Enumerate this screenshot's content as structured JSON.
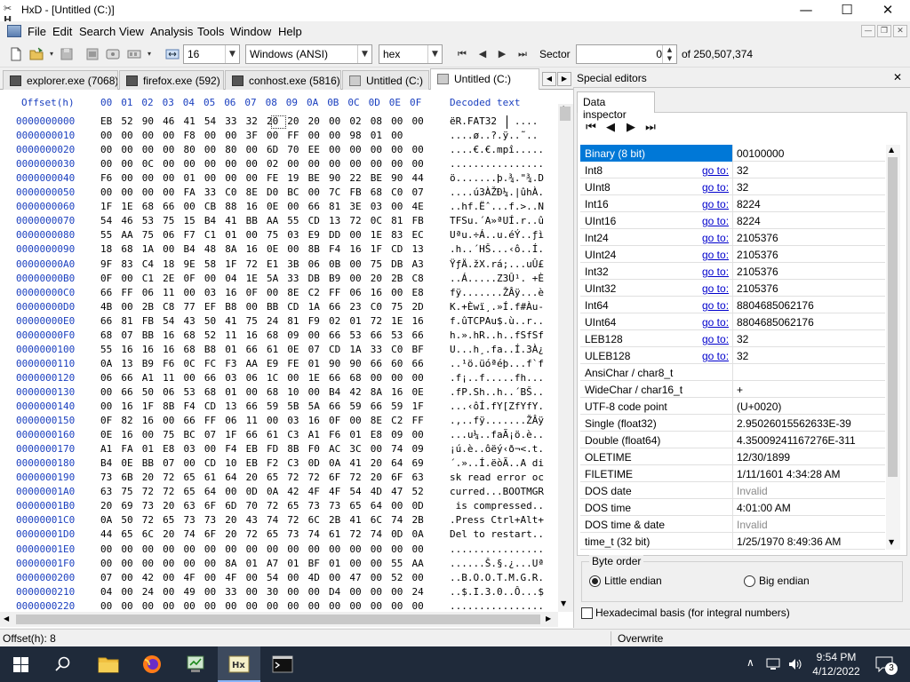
{
  "window": {
    "title": "HxD - [Untitled (C:)]",
    "app_icon_text": "✂H",
    "controls": {
      "minimize": "—",
      "maximize": "☐",
      "close": "✕"
    }
  },
  "menu": [
    "File",
    "Edit",
    "Search",
    "View",
    "Analysis",
    "Tools",
    "Window",
    "Help"
  ],
  "mdi_controls": {
    "minimize": "—",
    "restore": "❐",
    "close": "✕"
  },
  "toolbar": {
    "bytes_per_row": "16",
    "charset": "Windows (ANSI)",
    "offset_base": "hex",
    "sector_label": "Sector",
    "sector_value": "0",
    "sector_total": "of 250,507,374"
  },
  "tabs": [
    {
      "label": "explorer.exe (7068)"
    },
    {
      "label": "firefox.exe (592)"
    },
    {
      "label": "conhost.exe (5816)"
    },
    {
      "label": "Untitled (C:)"
    },
    {
      "label": "Untitled (C:)"
    }
  ],
  "hex": {
    "offset_header": "Offset(h)",
    "columns": [
      "00",
      "01",
      "02",
      "03",
      "04",
      "05",
      "06",
      "07",
      "08",
      "09",
      "0A",
      "0B",
      "0C",
      "0D",
      "0E",
      "0F"
    ],
    "decoded_header": "Decoded text",
    "rows": [
      {
        "offset": "0000000000",
        "bytes": "EB 52 90 46 41 54 33 32 20 20 20 00 02 08 00 00",
        "text": "ëR.FAT32   ...."
      },
      {
        "offset": "0000000010",
        "bytes": "00 00 00 00 F8 00 00 3F 00 FF 00 00 98 01 00",
        "text": "....ø..?.ÿ..˜.."
      },
      {
        "offset": "0000000020",
        "bytes": "00 00 00 00 80 00 80 00 6D 70 EE 00 00 00 00 00",
        "text": "....€.€.mpî....."
      },
      {
        "offset": "0000000030",
        "bytes": "00 00 0C 00 00 00 00 00 02 00 00 00 00 00 00 00",
        "text": "................"
      },
      {
        "offset": "0000000040",
        "bytes": "F6 00 00 00 01 00 00 00 FE 19 BE 90 22 BE 90 44",
        "text": "ö.......þ.¾.\"¾.D"
      },
      {
        "offset": "0000000050",
        "bytes": "00 00 00 00 FA 33 C0 8E D0 BC 00 7C FB 68 C0 07",
        "text": "....ú3ÀŽÐ¼.|ûhÀ."
      },
      {
        "offset": "0000000060",
        "bytes": "1F 1E 68 66 00 CB 88 16 0E 00 66 81 3E 03 00 4E",
        "text": "..hf.Ëˆ...f.>..N"
      },
      {
        "offset": "0000000070",
        "bytes": "54 46 53 75 15 B4 41 BB AA 55 CD 13 72 0C 81 FB",
        "text": "TFSu.´A»ªUÍ.r..û"
      },
      {
        "offset": "0000000080",
        "bytes": "55 AA 75 06 F7 C1 01 00 75 03 E9 DD 00 1E 83 EC",
        "text": "Uªu.÷Á..u.éÝ..ƒì"
      },
      {
        "offset": "0000000090",
        "bytes": "18 68 1A 00 B4 48 8A 16 0E 00 8B F4 16 1F CD 13",
        "text": ".h..´HŠ...‹ô..Í."
      },
      {
        "offset": "00000000A0",
        "bytes": "9F 83 C4 18 9E 58 1F 72 E1 3B 06 0B 00 75 DB A3",
        "text": "ŸƒÄ.žX.rá;...uÛ£"
      },
      {
        "offset": "00000000B0",
        "bytes": "0F 00 C1 2E 0F 00 04 1E 5A 33 DB B9 00 20 2B C8",
        "text": "..Á.....Z3Û¹. +È"
      },
      {
        "offset": "00000000C0",
        "bytes": "66 FF 06 11 00 03 16 0F 00 8E C2 FF 06 16 00 E8",
        "text": "fÿ.......ŽÂÿ...è"
      },
      {
        "offset": "00000000D0",
        "bytes": "4B 00 2B C8 77 EF B8 00 BB CD 1A 66 23 C0 75 2D",
        "text": "K.+Èwï¸.»Í.f#Àu-"
      },
      {
        "offset": "00000000E0",
        "bytes": "66 81 FB 54 43 50 41 75 24 81 F9 02 01 72 1E 16",
        "text": "f.ûTCPAu$.ù..r.."
      },
      {
        "offset": "00000000F0",
        "bytes": "68 07 BB 16 68 52 11 16 68 09 00 66 53 66 53 66",
        "text": "h.».hR..h..fSfSf"
      },
      {
        "offset": "0000000100",
        "bytes": "55 16 16 16 68 B8 01 66 61 0E 07 CD 1A 33 C0 BF",
        "text": "U...h¸.fa..Í.3À¿"
      },
      {
        "offset": "0000000110",
        "bytes": "0A 13 B9 F6 0C FC F3 AA E9 FE 01 90 90 66 60 66",
        "text": "..¹ö.üóªéþ...f`f"
      },
      {
        "offset": "0000000120",
        "bytes": "06 66 A1 11 00 66 03 06 1C 00 1E 66 68 00 00 00",
        "text": ".f¡..f.....fh..."
      },
      {
        "offset": "0000000130",
        "bytes": "00 66 50 06 53 68 01 00 68 10 00 B4 42 8A 16 0E",
        "text": ".fP.Sh..h..´BŠ.."
      },
      {
        "offset": "0000000140",
        "bytes": "00 16 1F 8B F4 CD 13 66 59 5B 5A 66 59 66 59 1F",
        "text": "...‹ôÍ.fY[ZfYfY."
      },
      {
        "offset": "0000000150",
        "bytes": "0F 82 16 00 66 FF 06 11 00 03 16 0F 00 8E C2 FF",
        "text": ".‚..fÿ.......ŽÂÿ"
      },
      {
        "offset": "0000000160",
        "bytes": "0E 16 00 75 BC 07 1F 66 61 C3 A1 F6 01 E8 09 00",
        "text": "...u¼..faÃ¡ö.è.."
      },
      {
        "offset": "0000000170",
        "bytes": "A1 FA 01 E8 03 00 F4 EB FD 8B F0 AC 3C 00 74 09",
        "text": "¡ú.è..ôëý‹ð¬<.t."
      },
      {
        "offset": "0000000180",
        "bytes": "B4 0E BB 07 00 CD 10 EB F2 C3 0D 0A 41 20 64 69",
        "text": "´.»..Í.ëòÃ..A di"
      },
      {
        "offset": "0000000190",
        "bytes": "73 6B 20 72 65 61 64 20 65 72 72 6F 72 20 6F 63",
        "text": "sk read error oc"
      },
      {
        "offset": "00000001A0",
        "bytes": "63 75 72 72 65 64 00 0D 0A 42 4F 4F 54 4D 47 52",
        "text": "curred...BOOTMGR"
      },
      {
        "offset": "00000001B0",
        "bytes": "20 69 73 20 63 6F 6D 70 72 65 73 73 65 64 00 0D",
        "text": " is compressed.."
      },
      {
        "offset": "00000001C0",
        "bytes": "0A 50 72 65 73 73 20 43 74 72 6C 2B 41 6C 74 2B",
        "text": ".Press Ctrl+Alt+"
      },
      {
        "offset": "00000001D0",
        "bytes": "44 65 6C 20 74 6F 20 72 65 73 74 61 72 74 0D 0A",
        "text": "Del to restart.."
      },
      {
        "offset": "00000001E0",
        "bytes": "00 00 00 00 00 00 00 00 00 00 00 00 00 00 00 00",
        "text": "................"
      },
      {
        "offset": "00000001F0",
        "bytes": "00 00 00 00 00 00 8A 01 A7 01 BF 01 00 00 55 AA",
        "text": "......Š.§.¿...Uª"
      },
      {
        "offset": "0000000200",
        "bytes": "07 00 42 00 4F 00 4F 00 54 00 4D 00 47 00 52 00",
        "text": "..B.O.O.T.M.G.R."
      },
      {
        "offset": "0000000210",
        "bytes": "04 00 24 00 49 00 33 00 30 00 00 D4 00 00 00 24",
        "text": "..$.I.3.0..Ô...$"
      },
      {
        "offset": "0000000220",
        "bytes": "00 00 00 00 00 00 00 00 00 00 00 00 00 00 00 00",
        "text": "................"
      }
    ]
  },
  "side": {
    "header": "Special editors",
    "close": "✕",
    "tab": "Data inspector",
    "nav": [
      "⏮",
      "◀",
      "▶",
      "⏭"
    ],
    "rows": [
      {
        "name": "Binary (8 bit)",
        "goto": "",
        "value": "00100000",
        "selected": true
      },
      {
        "name": "Int8",
        "goto": "go to:",
        "value": "32"
      },
      {
        "name": "UInt8",
        "goto": "go to:",
        "value": "32"
      },
      {
        "name": "Int16",
        "goto": "go to:",
        "value": "8224"
      },
      {
        "name": "UInt16",
        "goto": "go to:",
        "value": "8224"
      },
      {
        "name": "Int24",
        "goto": "go to:",
        "value": "2105376"
      },
      {
        "name": "UInt24",
        "goto": "go to:",
        "value": "2105376"
      },
      {
        "name": "Int32",
        "goto": "go to:",
        "value": "2105376"
      },
      {
        "name": "UInt32",
        "goto": "go to:",
        "value": "2105376"
      },
      {
        "name": "Int64",
        "goto": "go to:",
        "value": "8804685062176"
      },
      {
        "name": "UInt64",
        "goto": "go to:",
        "value": "8804685062176"
      },
      {
        "name": "LEB128",
        "goto": "go to:",
        "value": "32"
      },
      {
        "name": "ULEB128",
        "goto": "go to:",
        "value": "32"
      },
      {
        "name": "AnsiChar / char8_t",
        "goto": "",
        "value": ""
      },
      {
        "name": "WideChar / char16_t",
        "goto": "",
        "value": "+"
      },
      {
        "name": "UTF-8 code point",
        "goto": "",
        "value": " (U+0020)"
      },
      {
        "name": "Single (float32)",
        "goto": "",
        "value": "2.95026015562633E-39"
      },
      {
        "name": "Double (float64)",
        "goto": "",
        "value": "4.35009241167276E-311"
      },
      {
        "name": "OLETIME",
        "goto": "",
        "value": "12/30/1899"
      },
      {
        "name": "FILETIME",
        "goto": "",
        "value": "1/11/1601 4:34:28 AM"
      },
      {
        "name": "DOS date",
        "goto": "",
        "value": "Invalid",
        "muted": true
      },
      {
        "name": "DOS time",
        "goto": "",
        "value": "4:01:00 AM"
      },
      {
        "name": "DOS time & date",
        "goto": "",
        "value": "Invalid",
        "muted": true
      },
      {
        "name": "time_t (32 bit)",
        "goto": "",
        "value": "1/25/1970 8:49:36 AM"
      },
      {
        "name": "time_t (64 bit)",
        "goto": "",
        "value": "Invalid",
        "muted": true
      }
    ],
    "byte_order_label": "Byte order",
    "little_endian": "Little endian",
    "big_endian": "Big endian",
    "hex_basis": "Hexadecimal basis (for integral numbers)"
  },
  "status": {
    "offset": "Offset(h): 8",
    "mode": "Overwrite"
  },
  "taskbar": {
    "time": "9:54 PM",
    "date": "4/12/2022",
    "notifications": "3"
  },
  "colors": {
    "offset_blue": "#1a3fbf",
    "selection_blue": "#0078d7",
    "taskbar_bg": "#1f2a3a"
  }
}
